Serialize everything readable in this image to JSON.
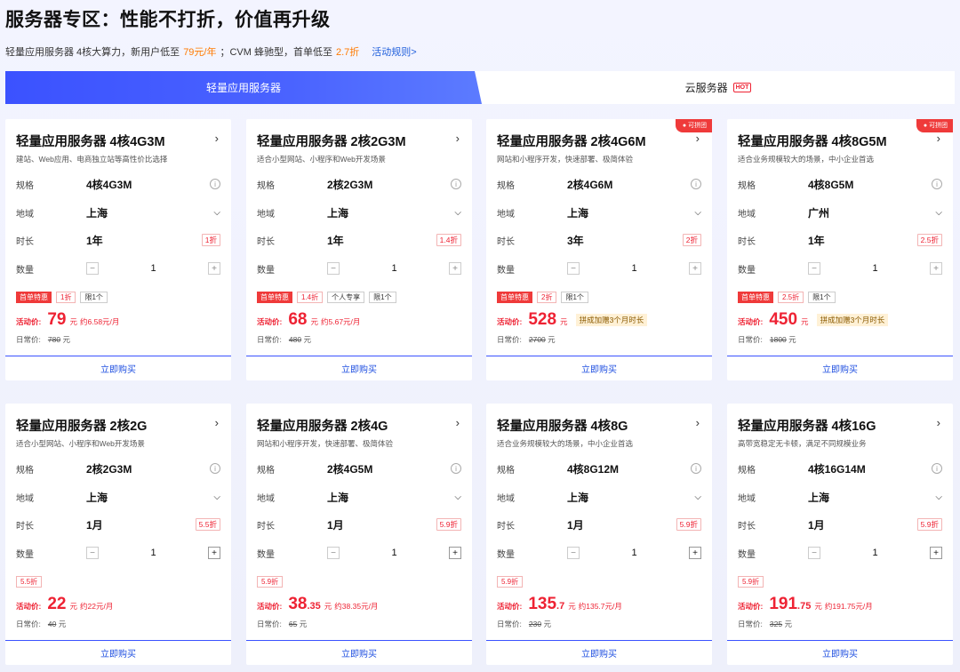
{
  "page": {
    "title": "服务器专区：性能不打折，价值再升级",
    "subtitle_a": "轻量应用服务器 4核大算力，新用户低至",
    "subtitle_price": "79元/年",
    "subtitle_b": "；CVM 蜂驰型，首单低至",
    "subtitle_disc": "2.7折",
    "subtitle_link": "活动规则>"
  },
  "tabs": {
    "active": "轻量应用服务器",
    "inactive": "云服务器",
    "hot": "HOT"
  },
  "labels": {
    "spec": "规格",
    "region": "地域",
    "duration": "时长",
    "quantity": "数量",
    "activity_price": "活动价:",
    "daily_price": "日常价:",
    "buy": "立即购买",
    "yuan": "元",
    "group": "可拼团",
    "minus": "−",
    "plus": "+",
    "arrow": "›",
    "chevron": "⌄",
    "info": "i"
  },
  "colors": {
    "accent": "#3b52ff",
    "price": "#e23",
    "tag": "#ef3a3a"
  },
  "cards": [
    {
      "title": "轻量应用服务器 4核4G3M",
      "desc": "建站、Web应用、电商独立站等高性价比选择",
      "spec": "4核4G3M",
      "region": "上海",
      "duration": "1年",
      "disc": "1折",
      "qty": "1",
      "group": false,
      "tags": [
        {
          "k": "red",
          "t": "首单特惠"
        },
        {
          "k": "outline-red",
          "t": "1折"
        },
        {
          "k": "outline",
          "t": "限1个"
        }
      ],
      "price_int": "79",
      "price_dec": "",
      "monthly": "约6.58元/月",
      "promo": "",
      "orig": "780"
    },
    {
      "title": "轻量应用服务器 2核2G3M",
      "desc": "适合小型网站、小程序和Web开发场景",
      "spec": "2核2G3M",
      "region": "上海",
      "duration": "1年",
      "disc": "1.4折",
      "qty": "1",
      "group": false,
      "tags": [
        {
          "k": "red",
          "t": "首单特惠"
        },
        {
          "k": "outline-red",
          "t": "1.4折"
        },
        {
          "k": "outline",
          "t": "个人专享"
        },
        {
          "k": "outline",
          "t": "限1个"
        }
      ],
      "price_int": "68",
      "price_dec": "",
      "monthly": "约5.67元/月",
      "promo": "",
      "orig": "480"
    },
    {
      "title": "轻量应用服务器 2核4G6M",
      "desc": "网站和小程序开发，快速部署、极简体验",
      "spec": "2核4G6M",
      "region": "上海",
      "duration": "3年",
      "disc": "2折",
      "qty": "1",
      "group": true,
      "tags": [
        {
          "k": "red",
          "t": "首单特惠"
        },
        {
          "k": "outline-red",
          "t": "2折"
        },
        {
          "k": "outline",
          "t": "限1个"
        }
      ],
      "price_int": "528",
      "price_dec": "",
      "monthly": "",
      "promo": "拼成加赠3个月时长",
      "orig": "2700"
    },
    {
      "title": "轻量应用服务器 4核8G5M",
      "desc": "适合业务规模较大的场景，中小企业首选",
      "spec": "4核8G5M",
      "region": "广州",
      "duration": "1年",
      "disc": "2.5折",
      "qty": "1",
      "group": true,
      "tags": [
        {
          "k": "red",
          "t": "首单特惠"
        },
        {
          "k": "outline-red",
          "t": "2.5折"
        },
        {
          "k": "outline",
          "t": "限1个"
        }
      ],
      "price_int": "450",
      "price_dec": "",
      "monthly": "",
      "promo": "拼成加赠3个月时长",
      "orig": "1800"
    },
    {
      "title": "轻量应用服务器 2核2G",
      "desc": "适合小型网站、小程序和Web开发场景",
      "spec": "2核2G3M",
      "region": "上海",
      "duration": "1月",
      "disc": "5.5折",
      "qty": "1",
      "group": false,
      "tags": [
        {
          "k": "outline-red",
          "t": "5.5折"
        }
      ],
      "price_int": "22",
      "price_dec": "",
      "monthly": "约22元/月",
      "promo": "",
      "orig": "40"
    },
    {
      "title": "轻量应用服务器 2核4G",
      "desc": "网站和小程序开发，快速部署、极简体验",
      "spec": "2核4G5M",
      "region": "上海",
      "duration": "1月",
      "disc": "5.9折",
      "qty": "1",
      "group": false,
      "tags": [
        {
          "k": "outline-red",
          "t": "5.9折"
        }
      ],
      "price_int": "38",
      "price_dec": ".35",
      "monthly": "约38.35元/月",
      "promo": "",
      "orig": "65"
    },
    {
      "title": "轻量应用服务器 4核8G",
      "desc": "适合业务规模较大的场景，中小企业首选",
      "spec": "4核8G12M",
      "region": "上海",
      "duration": "1月",
      "disc": "5.9折",
      "qty": "1",
      "group": false,
      "tags": [
        {
          "k": "outline-red",
          "t": "5.9折"
        }
      ],
      "price_int": "135",
      "price_dec": ".7",
      "monthly": "约135.7元/月",
      "promo": "",
      "orig": "230"
    },
    {
      "title": "轻量应用服务器 4核16G",
      "desc": "高带宽稳定无卡顿，满足不同规模业务",
      "spec": "4核16G14M",
      "region": "上海",
      "duration": "1月",
      "disc": "5.9折",
      "qty": "1",
      "group": false,
      "tags": [
        {
          "k": "outline-red",
          "t": "5.9折"
        }
      ],
      "price_int": "191",
      "price_dec": ".75",
      "monthly": "约191.75元/月",
      "promo": "",
      "orig": "325"
    }
  ]
}
